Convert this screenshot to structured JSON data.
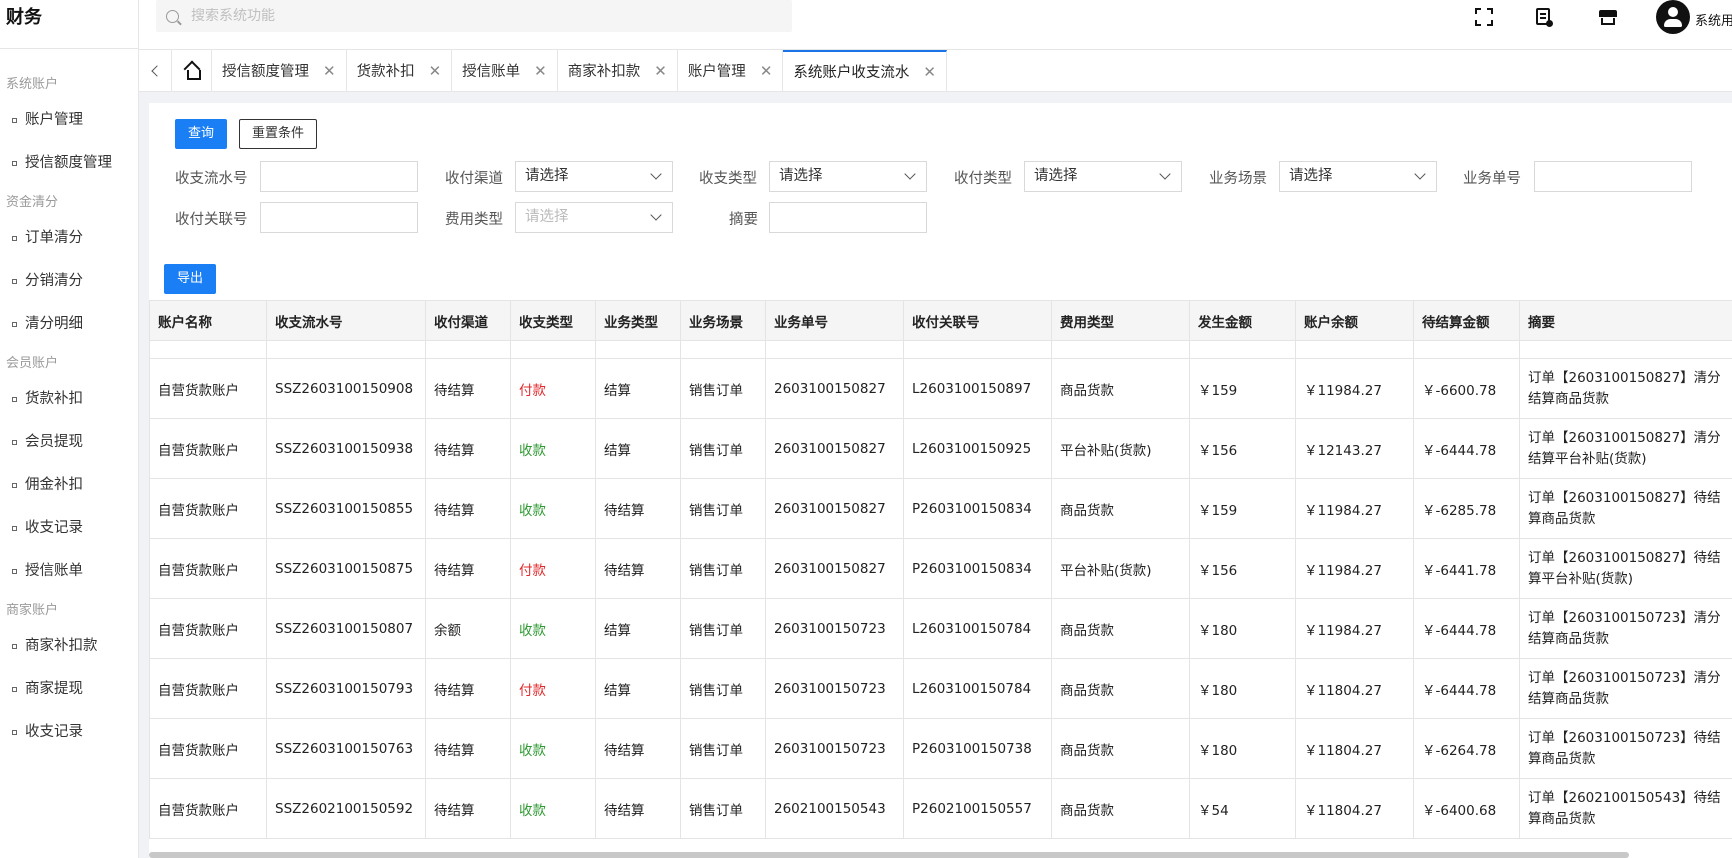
{
  "app": {
    "brand": "财务",
    "user_name": "系统用户"
  },
  "search": {
    "placeholder": "搜索系统功能"
  },
  "sidebar": {
    "groups": [
      {
        "title": "系统账户",
        "items": [
          "账户管理",
          "授信额度管理"
        ]
      },
      {
        "title": "资金清分",
        "items": [
          "订单清分",
          "分销清分",
          "清分明细"
        ]
      },
      {
        "title": "会员账户",
        "items": [
          "货款补扣",
          "会员提现",
          "佣金补扣",
          "收支记录",
          "授信账单"
        ]
      },
      {
        "title": "商家账户",
        "items": [
          "商家补扣款",
          "商家提现",
          "收支记录"
        ]
      }
    ]
  },
  "tabs": [
    {
      "label": "授信额度管理",
      "active": false
    },
    {
      "label": "货款补扣",
      "active": false
    },
    {
      "label": "授信账单",
      "active": false
    },
    {
      "label": "商家补扣款",
      "active": false
    },
    {
      "label": "账户管理",
      "active": false
    },
    {
      "label": "系统账户收支流水",
      "active": true
    }
  ],
  "filter": {
    "query_label": "查询",
    "reset_label": "重置条件",
    "flow_no_label": "收支流水号",
    "channel_label": "收付渠道",
    "channel_value": "请选择",
    "inout_type_label": "收支类型",
    "inout_type_value": "请选择",
    "pay_type_label": "收付类型",
    "pay_type_value": "请选择",
    "scene_label": "业务场景",
    "scene_value": "请选择",
    "biz_no_label": "业务单号",
    "pay_link_label": "收付关联号",
    "fee_type_label": "费用类型",
    "fee_type_placeholder": "请选择",
    "summary_label": "摘要"
  },
  "export_label": "导出",
  "table": {
    "headers": [
      "账户名称",
      "收支流水号",
      "收付渠道",
      "收支类型",
      "业务类型",
      "业务场景",
      "业务单号",
      "收付关联号",
      "费用类型",
      "发生金额",
      "账户余额",
      "待结算金额",
      "摘要"
    ],
    "rows": [
      [
        "自营货款账户",
        "SSZ2603100150908",
        "待结算",
        "付款",
        "结算",
        "销售订单",
        "2603100150827",
        "L2603100150897",
        "商品货款",
        "￥159",
        "￥11984.27",
        "￥-6600.78",
        "订单【2603100150827】清分结算商品货款"
      ],
      [
        "自营货款账户",
        "SSZ2603100150938",
        "待结算",
        "收款",
        "结算",
        "销售订单",
        "2603100150827",
        "L2603100150925",
        "平台补贴(货款)",
        "￥156",
        "￥12143.27",
        "￥-6444.78",
        "订单【2603100150827】清分结算平台补贴(货款)"
      ],
      [
        "自营货款账户",
        "SSZ2603100150855",
        "待结算",
        "收款",
        "待结算",
        "销售订单",
        "2603100150827",
        "P2603100150834",
        "商品货款",
        "￥159",
        "￥11984.27",
        "￥-6285.78",
        "订单【2603100150827】待结算商品货款"
      ],
      [
        "自营货款账户",
        "SSZ2603100150875",
        "待结算",
        "付款",
        "待结算",
        "销售订单",
        "2603100150827",
        "P2603100150834",
        "平台补贴(货款)",
        "￥156",
        "￥11984.27",
        "￥-6441.78",
        "订单【2603100150827】待结算平台补贴(货款)"
      ],
      [
        "自营货款账户",
        "SSZ2603100150807",
        "余额",
        "收款",
        "结算",
        "销售订单",
        "2603100150723",
        "L2603100150784",
        "商品货款",
        "￥180",
        "￥11984.27",
        "￥-6444.78",
        "订单【2603100150723】清分结算商品货款"
      ],
      [
        "自营货款账户",
        "SSZ2603100150793",
        "待结算",
        "付款",
        "结算",
        "销售订单",
        "2603100150723",
        "L2603100150784",
        "商品货款",
        "￥180",
        "￥11804.27",
        "￥-6444.78",
        "订单【2603100150723】清分结算商品货款"
      ],
      [
        "自营货款账户",
        "SSZ2603100150763",
        "待结算",
        "收款",
        "待结算",
        "销售订单",
        "2603100150723",
        "P2603100150738",
        "商品货款",
        "￥180",
        "￥11804.27",
        "￥-6264.78",
        "订单【2603100150723】待结算商品货款"
      ],
      [
        "自营货款账户",
        "SSZ2602100150592",
        "待结算",
        "收款",
        "待结算",
        "销售订单",
        "2602100150543",
        "P2602100150557",
        "商品货款",
        "￥54",
        "￥11804.27",
        "￥-6400.68",
        "订单【2602100150543】待结算商品货款"
      ]
    ]
  },
  "colors": {
    "primary": "#1a7ff5",
    "pay": "#e0282b",
    "receive": "#2d9a31",
    "active_tab": "#1a73e8"
  }
}
